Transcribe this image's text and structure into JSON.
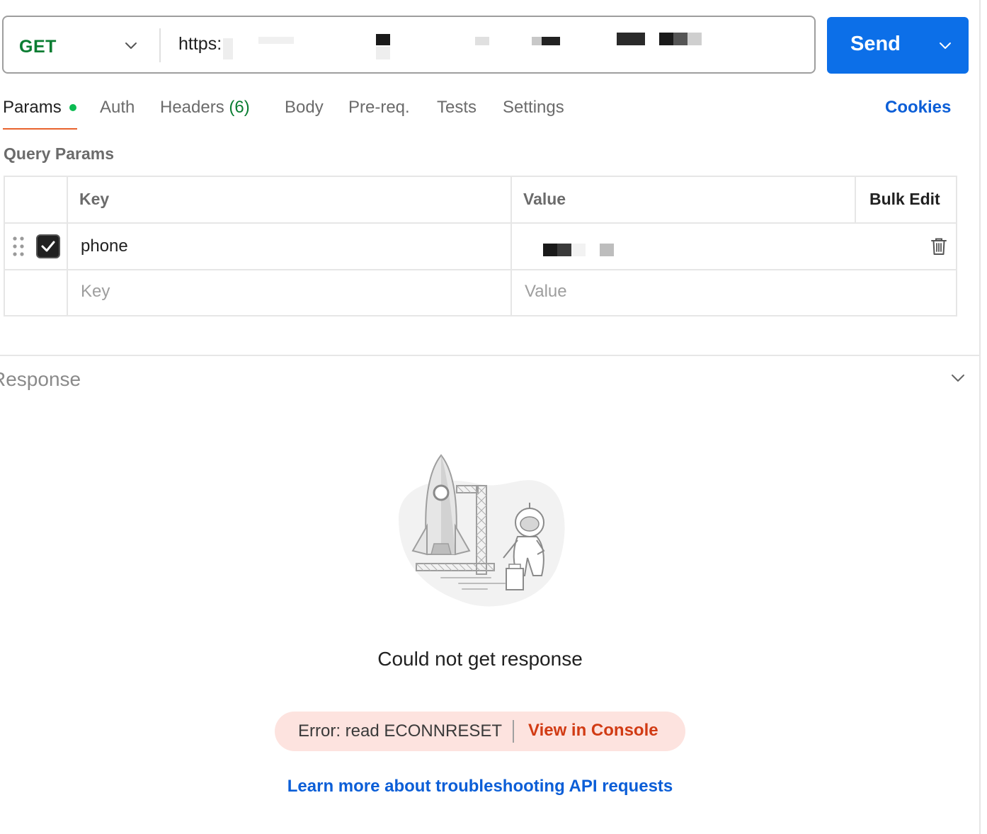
{
  "request": {
    "method": "GET",
    "url_visible": "https:",
    "send_label": "Send"
  },
  "tabs": [
    {
      "label": "Params"
    },
    {
      "label": "Auth"
    },
    {
      "label": "Headers",
      "count": "(6)"
    },
    {
      "label": "Body"
    },
    {
      "label": "Pre-req."
    },
    {
      "label": "Tests"
    },
    {
      "label": "Settings"
    }
  ],
  "cookies_label": "Cookies",
  "query_params": {
    "title": "Query Params",
    "headers": {
      "key": "Key",
      "value": "Value",
      "bulk_edit": "Bulk Edit"
    },
    "rows": [
      {
        "enabled": true,
        "key": "phone",
        "value": ""
      }
    ],
    "placeholder": {
      "key": "Key",
      "value": "Value"
    }
  },
  "response": {
    "title": "Response",
    "message": "Could not get response",
    "error_text": "Error: read ECONNRESET",
    "console_link": "View in Console",
    "learn_more": "Learn more about troubleshooting API requests"
  },
  "colors": {
    "method": "#0a7d32",
    "send": "#0c6fe8",
    "active_tab_underline": "#e8622d",
    "params_dot": "#0cbb52",
    "link": "#0b5ed7",
    "error_bg": "#fde3df",
    "error_link": "#d13b14"
  },
  "icons": [
    "chevron-down-icon",
    "drag-handle-icon",
    "checkmark-icon",
    "trash-icon",
    "rocket-illustration"
  ]
}
